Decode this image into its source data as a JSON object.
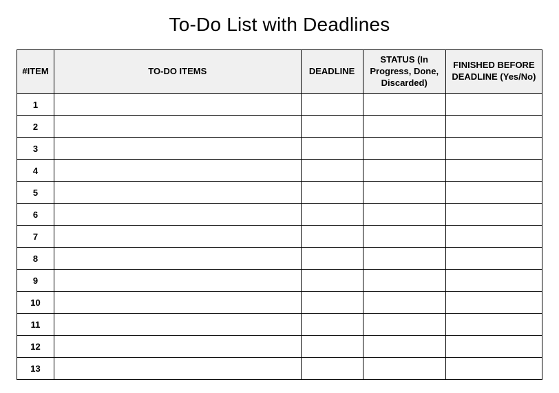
{
  "title": "To-Do List with Deadlines",
  "columns": {
    "item": "#ITEM",
    "todo": "TO-DO ITEMS",
    "deadline": "DEADLINE",
    "status": "STATUS (In Progress, Done, Discarded)",
    "finished": "FINISHED BEFORE DEADLINE (Yes/No)"
  },
  "rows": [
    {
      "num": "1",
      "todo": "",
      "deadline": "",
      "status": "",
      "finished": ""
    },
    {
      "num": "2",
      "todo": "",
      "deadline": "",
      "status": "",
      "finished": ""
    },
    {
      "num": "3",
      "todo": "",
      "deadline": "",
      "status": "",
      "finished": ""
    },
    {
      "num": "4",
      "todo": "",
      "deadline": "",
      "status": "",
      "finished": ""
    },
    {
      "num": "5",
      "todo": "",
      "deadline": "",
      "status": "",
      "finished": ""
    },
    {
      "num": "6",
      "todo": "",
      "deadline": "",
      "status": "",
      "finished": ""
    },
    {
      "num": "7",
      "todo": "",
      "deadline": "",
      "status": "",
      "finished": ""
    },
    {
      "num": "8",
      "todo": "",
      "deadline": "",
      "status": "",
      "finished": ""
    },
    {
      "num": "9",
      "todo": "",
      "deadline": "",
      "status": "",
      "finished": ""
    },
    {
      "num": "10",
      "todo": "",
      "deadline": "",
      "status": "",
      "finished": ""
    },
    {
      "num": "11",
      "todo": "",
      "deadline": "",
      "status": "",
      "finished": ""
    },
    {
      "num": "12",
      "todo": "",
      "deadline": "",
      "status": "",
      "finished": ""
    },
    {
      "num": "13",
      "todo": "",
      "deadline": "",
      "status": "",
      "finished": ""
    }
  ]
}
